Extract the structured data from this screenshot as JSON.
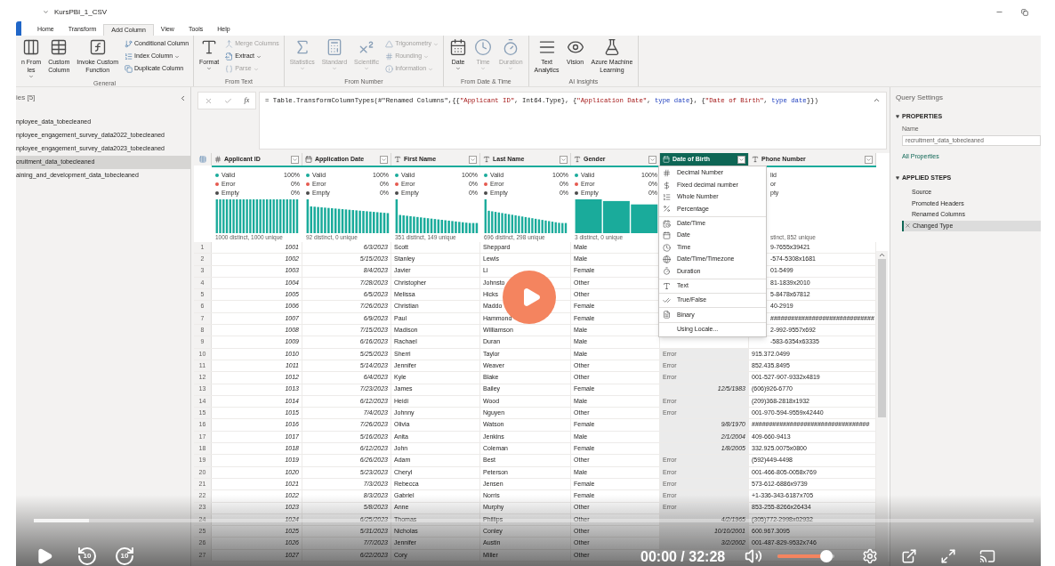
{
  "window": {
    "title": "KursPBI_1_CSV"
  },
  "ribbon_tabs": [
    {
      "label": "Home",
      "selected": false
    },
    {
      "label": "Transform",
      "selected": false
    },
    {
      "label": "Add Column",
      "selected": true
    },
    {
      "label": "View",
      "selected": false
    },
    {
      "label": "Tools",
      "selected": false
    },
    {
      "label": "Help",
      "selected": false
    }
  ],
  "ribbon_groups": [
    {
      "label": "General",
      "buttons": [
        {
          "kind": "large",
          "lines": [
            "n From",
            "les"
          ],
          "dropdown": true,
          "disabled": false
        },
        {
          "kind": "large",
          "lines": [
            "Custom",
            "Column"
          ],
          "dropdown": false,
          "disabled": false
        },
        {
          "kind": "large",
          "lines": [
            "Invoke Custom",
            "Function"
          ],
          "dropdown": false,
          "disabled": false
        },
        {
          "kind": "small",
          "lines": [
            "Conditional Column"
          ],
          "dropdown": false,
          "disabled": false
        },
        {
          "kind": "small",
          "lines": [
            "Index Column"
          ],
          "dropdown": true,
          "disabled": false
        },
        {
          "kind": "small",
          "lines": [
            "Duplicate Column"
          ],
          "dropdown": false,
          "disabled": false
        }
      ]
    },
    {
      "label": "From Text",
      "buttons": [
        {
          "kind": "large",
          "lines": [
            "Format"
          ],
          "dropdown": true,
          "disabled": false
        },
        {
          "kind": "small",
          "lines": [
            "Merge Columns"
          ],
          "dropdown": false,
          "disabled": true
        },
        {
          "kind": "small",
          "lines": [
            "Extract"
          ],
          "dropdown": true,
          "disabled": false
        },
        {
          "kind": "small",
          "lines": [
            "Parse"
          ],
          "dropdown": true,
          "disabled": true
        }
      ]
    },
    {
      "label": "From Number",
      "buttons": [
        {
          "kind": "large",
          "lines": [
            "Statistics"
          ],
          "dropdown": true,
          "disabled": true
        },
        {
          "kind": "large",
          "lines": [
            "Standard"
          ],
          "dropdown": true,
          "disabled": true
        },
        {
          "kind": "large",
          "lines": [
            "Scientific"
          ],
          "dropdown": true,
          "disabled": true
        },
        {
          "kind": "small",
          "lines": [
            "Trigonometry"
          ],
          "dropdown": true,
          "disabled": true
        },
        {
          "kind": "small",
          "lines": [
            "Rounding"
          ],
          "dropdown": true,
          "disabled": true
        },
        {
          "kind": "small",
          "lines": [
            "Information"
          ],
          "dropdown": true,
          "disabled": true
        }
      ]
    },
    {
      "label": "From Date & Time",
      "buttons": [
        {
          "kind": "large",
          "lines": [
            "Date"
          ],
          "dropdown": true,
          "disabled": false
        },
        {
          "kind": "large",
          "lines": [
            "Time"
          ],
          "dropdown": true,
          "disabled": true
        },
        {
          "kind": "large",
          "lines": [
            "Duration"
          ],
          "dropdown": true,
          "disabled": true
        }
      ]
    },
    {
      "label": "AI Insights",
      "buttons": [
        {
          "kind": "large",
          "lines": [
            "Text",
            "Analytics"
          ],
          "dropdown": false,
          "disabled": false
        },
        {
          "kind": "large",
          "lines": [
            "Vision"
          ],
          "dropdown": false,
          "disabled": false
        },
        {
          "kind": "large",
          "lines": [
            "Azure Machine",
            "Learning"
          ],
          "dropdown": false,
          "disabled": false
        }
      ]
    }
  ],
  "queries": {
    "title": "ies [5]",
    "items": [
      {
        "label": "nployee_data_tobecleaned",
        "selected": false
      },
      {
        "label": "nployee_engagement_survey_data2022_tobecleaned",
        "selected": false
      },
      {
        "label": "nployee_engagement_survey_data2023_tobecleaned",
        "selected": false
      },
      {
        "label": "cruitment_data_tobecleaned",
        "selected": true
      },
      {
        "label": "aining_and_development_data_tobecleaned",
        "selected": false
      }
    ]
  },
  "formula_bar": {
    "insert_function": "fx",
    "tokens": [
      {
        "kind": "plain",
        "text": "= Table.TransformColumnTypes(#\"Renamed Columns\",{{"
      },
      {
        "kind": "string",
        "text": "\"Applicant ID\""
      },
      {
        "kind": "plain",
        "text": ", Int64.Type}, {"
      },
      {
        "kind": "string",
        "text": "\"Application Date\""
      },
      {
        "kind": "plain",
        "text": ", "
      },
      {
        "kind": "keyword",
        "text": "type date"
      },
      {
        "kind": "plain",
        "text": "}, {"
      },
      {
        "kind": "string",
        "text": "\"Date of Birth\""
      },
      {
        "kind": "plain",
        "text": ", "
      },
      {
        "kind": "keyword",
        "text": "type date"
      },
      {
        "kind": "plain",
        "text": "}})"
      }
    ]
  },
  "table": {
    "columns": [
      {
        "name": "Applicant ID",
        "kind": "number",
        "selected": false,
        "histogram": true,
        "quality": [
          {
            "label": "Valid",
            "value": "100%",
            "color": "#1aab9b"
          },
          {
            "label": "Error",
            "value": "0%",
            "color": "#e5594f"
          },
          {
            "label": "Empty",
            "value": "0%",
            "color": "#4b4b4b"
          }
        ],
        "distribution": "1000 distinct, 1000 unique"
      },
      {
        "name": "Application Date",
        "kind": "date",
        "selected": false,
        "histogram": true,
        "quality": [
          {
            "label": "Valid",
            "value": "100%",
            "color": "#1aab9b"
          },
          {
            "label": "Error",
            "value": "0%",
            "color": "#e5594f"
          },
          {
            "label": "Empty",
            "value": "0%",
            "color": "#4b4b4b"
          }
        ],
        "distribution": "92 distinct, 0 unique"
      },
      {
        "name": "First Name",
        "kind": "text",
        "selected": false,
        "histogram": true,
        "quality": [
          {
            "label": "Valid",
            "value": "100%",
            "color": "#1aab9b"
          },
          {
            "label": "Error",
            "value": "0%",
            "color": "#e5594f"
          },
          {
            "label": "Empty",
            "value": "0%",
            "color": "#4b4b4b"
          }
        ],
        "distribution": "351 distinct, 149 unique"
      },
      {
        "name": "Last Name",
        "kind": "text",
        "selected": false,
        "histogram": true,
        "quality": [
          {
            "label": "Valid",
            "value": "100%",
            "color": "#1aab9b"
          },
          {
            "label": "Error",
            "value": "0%",
            "color": "#e5594f"
          },
          {
            "label": "Empty",
            "value": "0%",
            "color": "#4b4b4b"
          }
        ],
        "distribution": "696 distinct, 298 unique"
      },
      {
        "name": "Gender",
        "kind": "text",
        "selected": false,
        "histogram": true,
        "quality": [
          {
            "label": "Valid",
            "value": "100%",
            "color": "#1aab9b"
          },
          {
            "label": "Error",
            "value": "0%",
            "color": "#e5594f"
          },
          {
            "label": "Empty",
            "value": "0%",
            "color": "#4b4b4b"
          }
        ],
        "distribution": "3 distinct, 0 unique"
      },
      {
        "name": "Date of Birth",
        "kind": "date",
        "selected": true
      },
      {
        "name": "Phone Number",
        "kind": "text",
        "selected": false,
        "quality": [
          {
            "label": "lid"
          },
          {
            "label": "or"
          },
          {
            "label": "pty"
          }
        ],
        "distribution": "stinct, 852 unique"
      }
    ],
    "rows": [
      {
        "row_number": "1",
        "applicant_id": "1001",
        "application_date": "6/3/2023",
        "first_name": "Scott",
        "last_name": "Sheppard",
        "gender": "Male",
        "phone_number": "9-7655x39421"
      },
      {
        "row_number": "2",
        "applicant_id": "1002",
        "application_date": "5/15/2023",
        "first_name": "Stanley",
        "last_name": "Lewis",
        "gender": "Male",
        "phone_number": "-574-5308x1681"
      },
      {
        "row_number": "3",
        "applicant_id": "1003",
        "application_date": "8/4/2023",
        "first_name": "Javier",
        "last_name": "Li",
        "gender": "Female",
        "phone_number": "01-5499"
      },
      {
        "row_number": "4",
        "applicant_id": "1004",
        "application_date": "7/28/2023",
        "first_name": "Christopher",
        "last_name": "Johnsto",
        "gender": "Other",
        "phone_number": "81-1839x2010"
      },
      {
        "row_number": "5",
        "applicant_id": "1005",
        "application_date": "6/5/2023",
        "first_name": "Melissa",
        "last_name": "Hicks",
        "gender": "Other",
        "phone_number": "5-8478x67812"
      },
      {
        "row_number": "6",
        "applicant_id": "1006",
        "application_date": "7/26/2023",
        "first_name": "Christian",
        "last_name": "Maddo",
        "gender": "Female",
        "phone_number": "40-2919"
      },
      {
        "row_number": "7",
        "applicant_id": "1007",
        "application_date": "6/9/2023",
        "first_name": "Paul",
        "last_name": "Hammond",
        "gender": "Female",
        "phone_number": "##############################"
      },
      {
        "row_number": "8",
        "applicant_id": "1008",
        "application_date": "7/15/2023",
        "first_name": "Madison",
        "last_name": "Williamson",
        "gender": "Male",
        "phone_number": "2-992-9557x692"
      },
      {
        "row_number": "9",
        "applicant_id": "1009",
        "application_date": "6/16/2023",
        "first_name": "Rachael",
        "last_name": "Duran",
        "gender": "Male",
        "phone_number": "-583-6354x63335"
      },
      {
        "row_number": "10",
        "applicant_id": "1010",
        "application_date": "5/25/2023",
        "first_name": "Sherri",
        "last_name": "Taylor",
        "gender": "Male",
        "date_of_birth": "Error",
        "dob_error": true,
        "phone_number": "915.372.0499"
      },
      {
        "row_number": "11",
        "applicant_id": "1011",
        "application_date": "5/14/2023",
        "first_name": "Jennifer",
        "last_name": "Weaver",
        "gender": "Other",
        "date_of_birth": "Error",
        "dob_error": true,
        "phone_number": "852.435.8495"
      },
      {
        "row_number": "12",
        "applicant_id": "1012",
        "application_date": "6/4/2023",
        "first_name": "Kyle",
        "last_name": "Blake",
        "gender": "Other",
        "date_of_birth": "Error",
        "dob_error": true,
        "phone_number": "001-527-907-9332x4819"
      },
      {
        "row_number": "13",
        "applicant_id": "1013",
        "application_date": "7/23/2023",
        "first_name": "James",
        "last_name": "Bailey",
        "gender": "Female",
        "date_of_birth": "12/5/1983",
        "dob_error": false,
        "phone_number": "(606)926-6770"
      },
      {
        "row_number": "14",
        "applicant_id": "1014",
        "application_date": "6/12/2023",
        "first_name": "Heidi",
        "last_name": "Wood",
        "gender": "Male",
        "date_of_birth": "Error",
        "dob_error": true,
        "phone_number": "(209)368-2818x1932"
      },
      {
        "row_number": "15",
        "applicant_id": "1015",
        "application_date": "7/4/2023",
        "first_name": "Johnny",
        "last_name": "Nguyen",
        "gender": "Other",
        "date_of_birth": "Error",
        "dob_error": true,
        "phone_number": "001-970-594-9559x42440"
      },
      {
        "row_number": "16",
        "applicant_id": "1016",
        "application_date": "7/26/2023",
        "first_name": "Olivia",
        "last_name": "Watson",
        "gender": "Female",
        "date_of_birth": "9/8/1970",
        "dob_error": false,
        "phone_number": "##################################"
      },
      {
        "row_number": "17",
        "applicant_id": "1017",
        "application_date": "5/16/2023",
        "first_name": "Anita",
        "last_name": "Jenkins",
        "gender": "Male",
        "date_of_birth": "2/1/2004",
        "dob_error": false,
        "phone_number": "409-660-9413"
      },
      {
        "row_number": "18",
        "applicant_id": "1018",
        "application_date": "6/12/2023",
        "first_name": "John",
        "last_name": "Coleman",
        "gender": "Female",
        "date_of_birth": "1/8/2005",
        "dob_error": false,
        "phone_number": "332.925.0075x0800"
      },
      {
        "row_number": "19",
        "applicant_id": "1019",
        "application_date": "6/26/2023",
        "first_name": "Adam",
        "last_name": "Best",
        "gender": "Other",
        "date_of_birth": "Error",
        "dob_error": true,
        "phone_number": "(592)449-4498"
      },
      {
        "row_number": "20",
        "applicant_id": "1020",
        "application_date": "5/23/2023",
        "first_name": "Cheryl",
        "last_name": "Peterson",
        "gender": "Male",
        "date_of_birth": "Error",
        "dob_error": true,
        "phone_number": "001-466-805-0058x769"
      },
      {
        "row_number": "21",
        "applicant_id": "1021",
        "application_date": "7/3/2023",
        "first_name": "Rebecca",
        "last_name": "Jensen",
        "gender": "Female",
        "date_of_birth": "Error",
        "dob_error": true,
        "phone_number": "573-612-6886x9739"
      },
      {
        "row_number": "22",
        "applicant_id": "1022",
        "application_date": "8/3/2023",
        "first_name": "Gabriel",
        "last_name": "Norris",
        "gender": "Female",
        "date_of_birth": "Error",
        "dob_error": true,
        "phone_number": "+1-336-343-6187x705"
      },
      {
        "row_number": "23",
        "applicant_id": "1023",
        "application_date": "5/8/2023",
        "first_name": "Anne",
        "last_name": "Murphy",
        "gender": "Other",
        "date_of_birth": "Error",
        "dob_error": true,
        "phone_number": "853-255-8266x26434"
      },
      {
        "row_number": "24",
        "applicant_id": "1024",
        "application_date": "6/25/2023",
        "first_name": "Thomas",
        "last_name": "Phillips",
        "gender": "Other",
        "date_of_birth": "4/2/1965",
        "dob_error": false,
        "phone_number": "(305)772-2998x02932"
      },
      {
        "row_number": "25",
        "applicant_id": "1025",
        "application_date": "5/31/2023",
        "first_name": "Nicholas",
        "last_name": "Conley",
        "gender": "Other",
        "date_of_birth": "10/10/2001",
        "dob_error": false,
        "phone_number": "600.967.3095"
      },
      {
        "row_number": "26",
        "applicant_id": "1026",
        "application_date": "7/7/2023",
        "first_name": "Jennifer",
        "last_name": "Austin",
        "gender": "Other",
        "date_of_birth": "3/2/2002",
        "dob_error": false,
        "phone_number": "001-487-829-9532x746"
      },
      {
        "row_number": "27",
        "applicant_id": "1027",
        "application_date": "6/22/2023",
        "first_name": "Cory",
        "last_name": "Miller",
        "gender": "Other"
      }
    ]
  },
  "type_menu": {
    "sections": [
      [
        {
          "label": "Decimal Number"
        },
        {
          "label": "Fixed decimal number"
        },
        {
          "label": "Whole Number"
        },
        {
          "label": "Percentage"
        }
      ],
      [
        {
          "label": "Date/Time"
        },
        {
          "label": "Date"
        },
        {
          "label": "Time"
        },
        {
          "label": "Date/Time/Timezone"
        },
        {
          "label": "Duration"
        }
      ],
      [
        {
          "label": "Text"
        }
      ],
      [
        {
          "label": "True/False"
        }
      ],
      [
        {
          "label": "Binary"
        }
      ],
      [
        {
          "label": "Using Locale..."
        }
      ]
    ]
  },
  "query_settings": {
    "title": "Query Settings",
    "properties": {
      "heading": "PROPERTIES",
      "expanded": true,
      "name_label": "Name",
      "name_value": "recruitment_data_tobecleaned",
      "link": "All Properties"
    },
    "applied_steps": {
      "heading": "APPLIED STEPS",
      "expanded": true,
      "steps": [
        {
          "label": "Source",
          "selected": false
        },
        {
          "label": "Promoted Headers",
          "selected": false
        },
        {
          "label": "Renamed Columns",
          "selected": false
        },
        {
          "label": "Changed Type",
          "selected": true
        }
      ]
    }
  },
  "video_player": {
    "progress": {
      "level": 0.055
    },
    "skip_back": "10",
    "skip_forward": "10",
    "time": "00:00 / 32:28",
    "volume": {
      "level": 0.85
    }
  }
}
